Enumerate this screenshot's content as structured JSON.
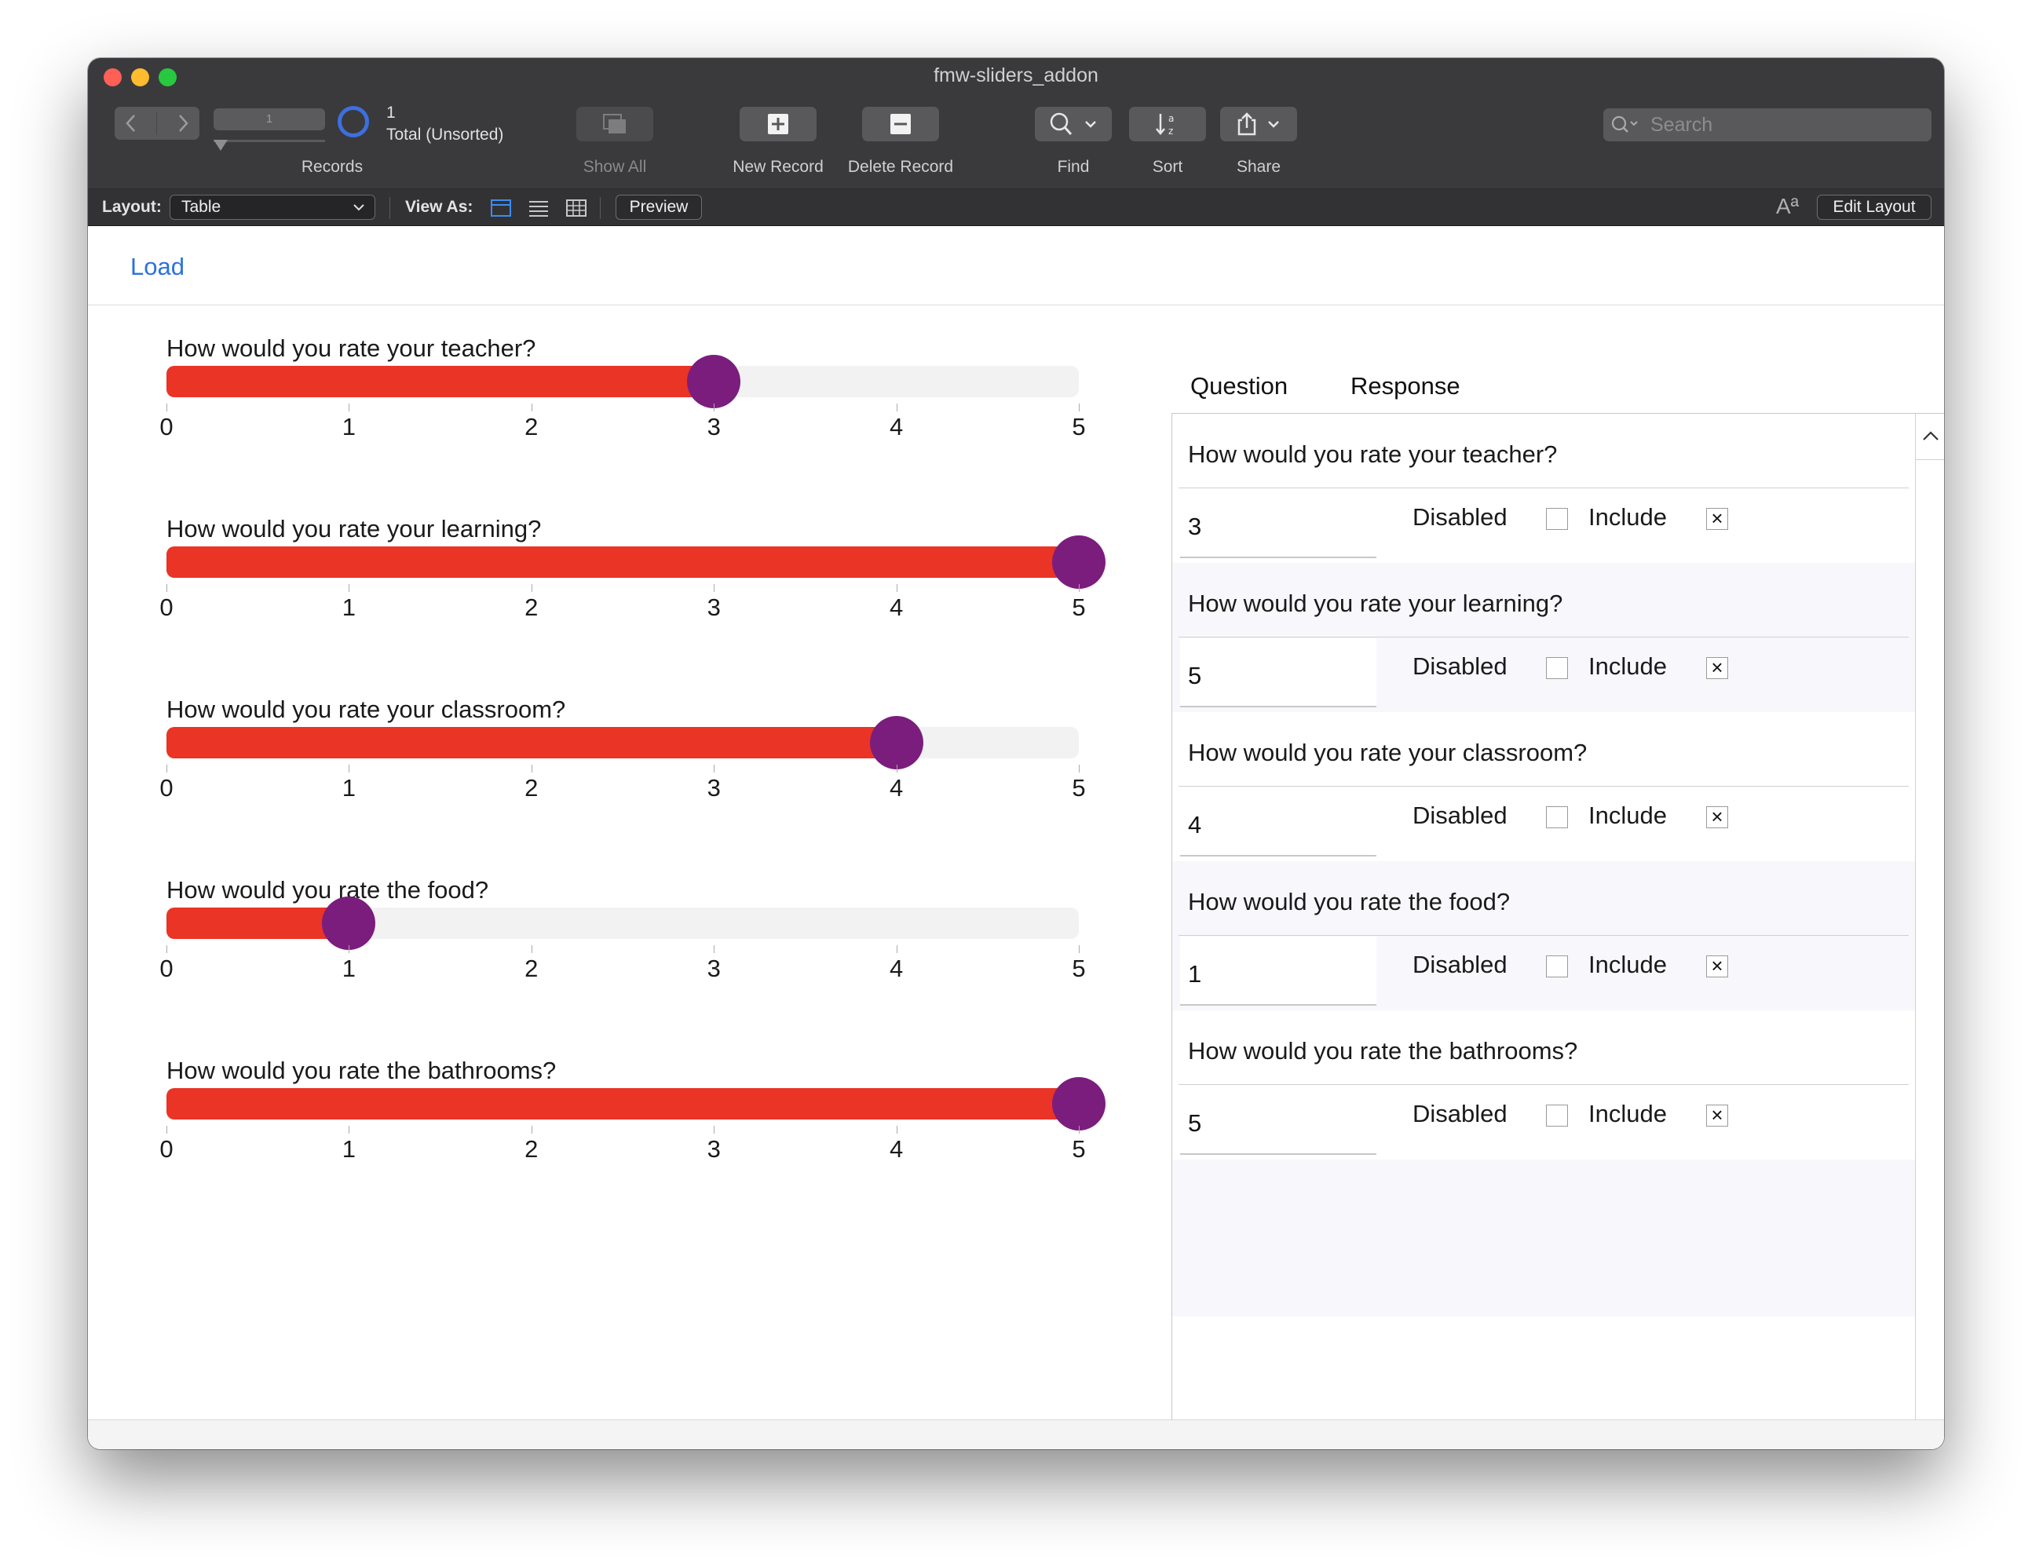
{
  "window": {
    "title": "fmw-sliders_addon"
  },
  "toolbar": {
    "record_number": "1",
    "record_slider_value": "1",
    "total_label": "Total (Unsorted)",
    "records_label": "Records",
    "show_all_label": "Show All",
    "new_record_label": "New Record",
    "delete_record_label": "Delete Record",
    "find_label": "Find",
    "sort_label": "Sort",
    "share_label": "Share",
    "search_placeholder": "Search"
  },
  "layoutbar": {
    "layout_label": "Layout:",
    "layout_value": "Table",
    "view_as_label": "View As:",
    "preview_label": "Preview",
    "text_size_glyph": "Aª",
    "edit_layout_label": "Edit Layout"
  },
  "content": {
    "load_label": "Load",
    "scale": {
      "min": 0,
      "max": 5,
      "ticks": [
        "0",
        "1",
        "2",
        "3",
        "4",
        "5"
      ]
    },
    "sliders": [
      {
        "question": "How would you rate your teacher?",
        "value": 3
      },
      {
        "question": "How would you rate your learning?",
        "value": 5
      },
      {
        "question": "How would you rate your classroom?",
        "value": 4
      },
      {
        "question": "How would you rate the food?",
        "value": 1
      },
      {
        "question": "How would you rate the bathrooms?",
        "value": 5
      }
    ]
  },
  "portal": {
    "question_header": "Question",
    "response_header": "Response",
    "disabled_label": "Disabled",
    "include_label": "Include",
    "rows": [
      {
        "question": "How would you rate your teacher?",
        "response": "3",
        "disabled": false,
        "include": true
      },
      {
        "question": "How would you rate your learning?",
        "response": "5",
        "disabled": false,
        "include": true
      },
      {
        "question": "How would you rate your classroom?",
        "response": "4",
        "disabled": false,
        "include": true
      },
      {
        "question": "How would you rate the food?",
        "response": "1",
        "disabled": false,
        "include": true
      },
      {
        "question": "How would you rate the bathrooms?",
        "response": "5",
        "disabled": false,
        "include": true
      }
    ]
  },
  "colors": {
    "slider_fill": "#e93426",
    "slider_thumb": "#7b1d7d",
    "slider_track": "#f2f2f2",
    "link": "#2b72dd",
    "toolbar_bg": "#3a3a3c"
  }
}
